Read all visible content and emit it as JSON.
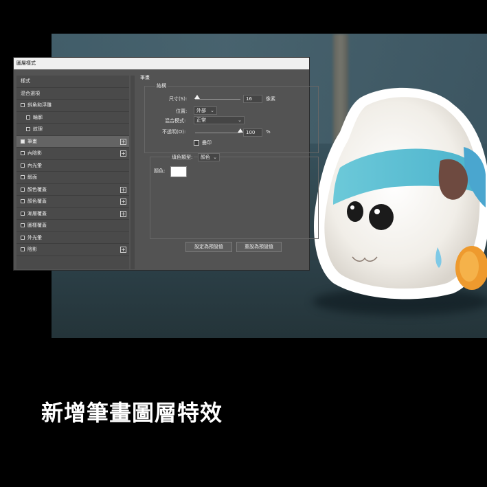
{
  "dialog": {
    "title": "圖層樣式",
    "left_panel": {
      "items": [
        {
          "label": "樣式",
          "checkbox": false,
          "plus": false,
          "selected": false,
          "indent": false
        },
        {
          "label": "混合選項",
          "checkbox": false,
          "plus": false,
          "selected": false,
          "indent": false
        },
        {
          "label": "斜角和浮雕",
          "checkbox": true,
          "checked": false,
          "plus": false,
          "selected": false,
          "indent": false
        },
        {
          "label": "輪廓",
          "checkbox": true,
          "checked": false,
          "plus": false,
          "selected": false,
          "indent": true
        },
        {
          "label": "紋理",
          "checkbox": true,
          "checked": false,
          "plus": false,
          "selected": false,
          "indent": true
        },
        {
          "label": "筆畫",
          "checkbox": true,
          "checked": true,
          "plus": true,
          "selected": true,
          "indent": false
        },
        {
          "label": "內陰影",
          "checkbox": true,
          "checked": false,
          "plus": true,
          "selected": false,
          "indent": false
        },
        {
          "label": "內光暈",
          "checkbox": true,
          "checked": false,
          "plus": false,
          "selected": false,
          "indent": false
        },
        {
          "label": "緞面",
          "checkbox": true,
          "checked": false,
          "plus": false,
          "selected": false,
          "indent": false
        },
        {
          "label": "顏色覆蓋",
          "checkbox": true,
          "checked": false,
          "plus": true,
          "selected": false,
          "indent": false
        },
        {
          "label": "顏色覆蓋",
          "checkbox": true,
          "checked": false,
          "plus": true,
          "selected": false,
          "indent": false
        },
        {
          "label": "漸層覆蓋",
          "checkbox": true,
          "checked": false,
          "plus": true,
          "selected": false,
          "indent": false
        },
        {
          "label": "圖樣覆蓋",
          "checkbox": true,
          "checked": false,
          "plus": false,
          "selected": false,
          "indent": false
        },
        {
          "label": "外光暈",
          "checkbox": true,
          "checked": false,
          "plus": false,
          "selected": false,
          "indent": false
        },
        {
          "label": "陰影",
          "checkbox": true,
          "checked": false,
          "plus": true,
          "selected": false,
          "indent": false
        }
      ]
    },
    "stroke": {
      "section_title": "筆畫",
      "structure_title": "結構",
      "size_label": "尺寸(S):",
      "size_value": "16",
      "size_unit": "像素",
      "size_slider_fraction": 0.05,
      "position_label": "位置:",
      "position_value": "外部",
      "blend_label": "混合模式:",
      "blend_value": "正常",
      "opacity_label": "不透明(O):",
      "opacity_value": "100",
      "opacity_unit": "%",
      "opacity_slider_fraction": 1.0,
      "overprint_label": "疊印",
      "fill_type_label": "填色類型:",
      "fill_type_value": "顏色",
      "color_label": "顏色:",
      "color_swatch": "#ffffff",
      "set_default_button": "設定為預設值",
      "reset_default_button": "重設為預設值"
    }
  },
  "caption": "新增筆畫圖層特效",
  "colors": {
    "background": "#000000",
    "dialog_bg": "#535353",
    "selected_row": "#646464"
  }
}
